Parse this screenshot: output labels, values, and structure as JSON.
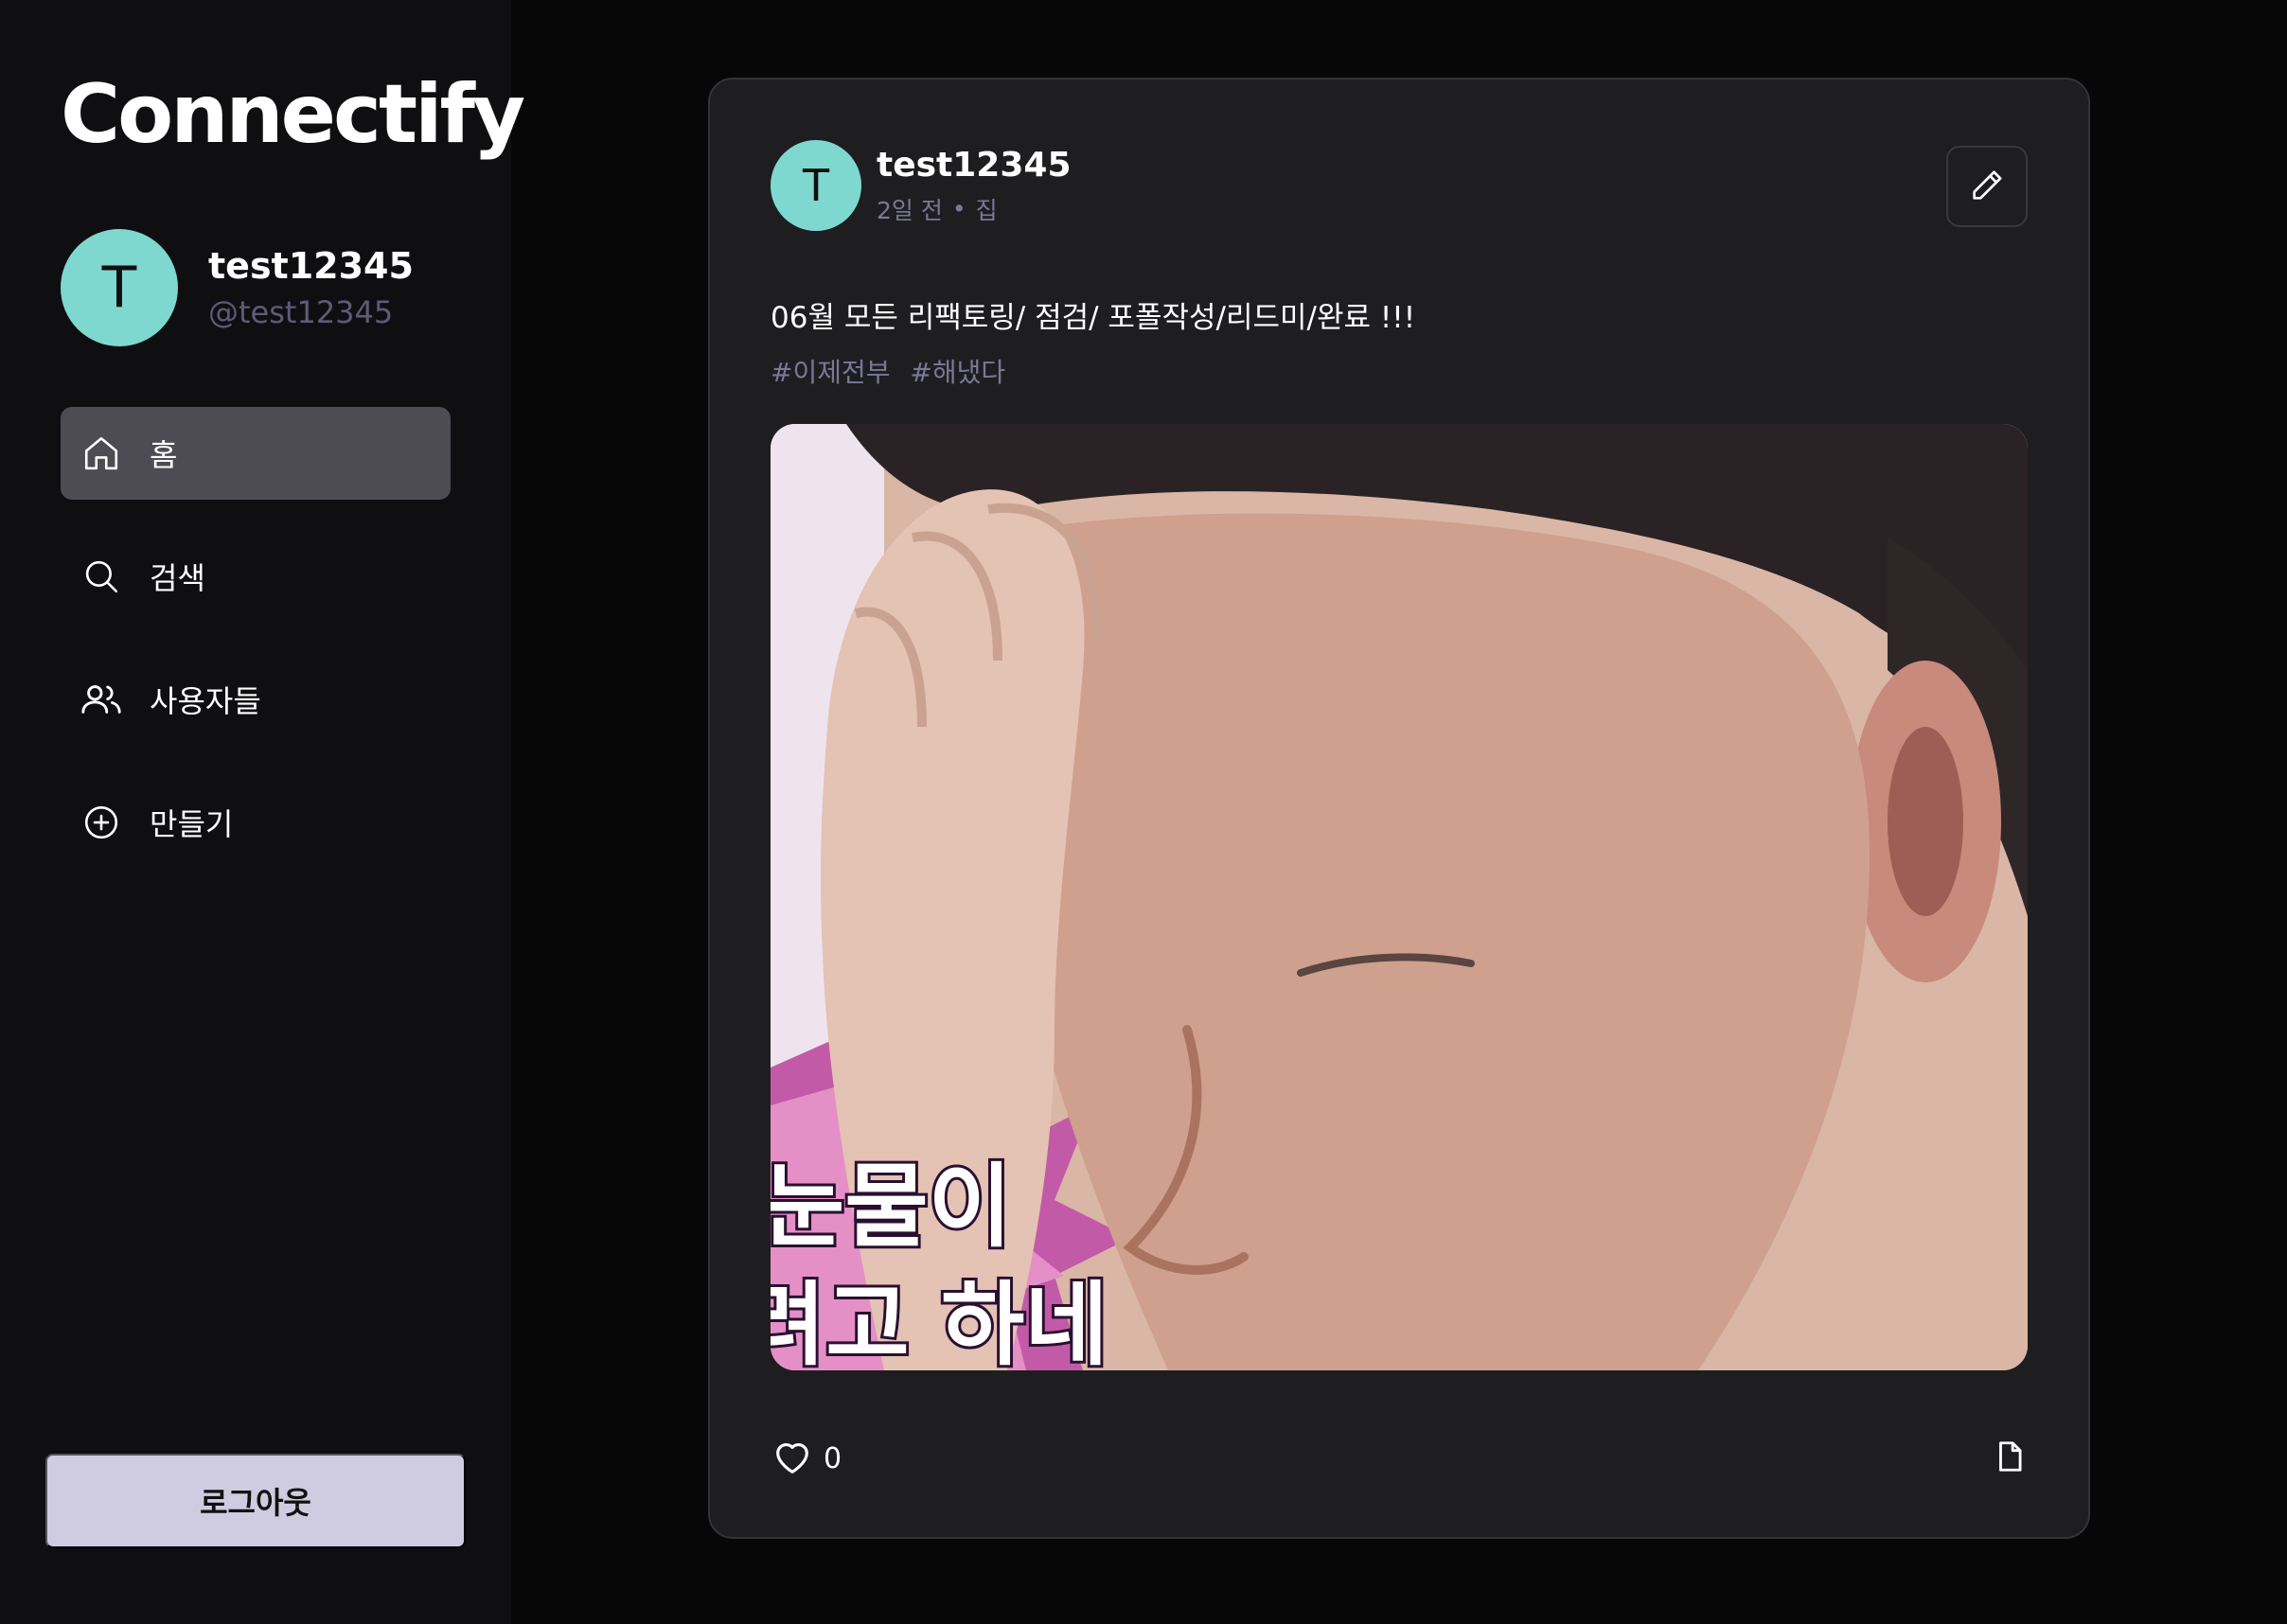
{
  "app": {
    "brand": "Connectify"
  },
  "user": {
    "initial": "T",
    "name": "test12345",
    "handle": "@test12345"
  },
  "nav": {
    "items": [
      {
        "label": "홈",
        "icon": "home-icon",
        "active": true
      },
      {
        "label": "검색",
        "icon": "search-icon",
        "active": false
      },
      {
        "label": "사용자들",
        "icon": "users-icon",
        "active": false
      },
      {
        "label": "만들기",
        "icon": "plus-circle-icon",
        "active": false
      }
    ]
  },
  "logout_label": "로그아웃",
  "post": {
    "author_initial": "T",
    "author": "test12345",
    "time": "2일 전",
    "separator": "•",
    "location": "집",
    "text": "06월 모든 리팩토링/ 점검/ 포폴작성/리드미/완료 !!!",
    "tags": [
      "#이제전부",
      "#해냈다"
    ],
    "image_caption_line1": "눈물이",
    "image_caption_line2": "려고 하네",
    "likes": "0",
    "edit_icon": "pencil-icon",
    "like_icon": "heart-icon",
    "save_icon": "document-icon"
  },
  "colors": {
    "background": "#070708",
    "sidebar": "#0f0f11",
    "card": "#1e1e21",
    "avatar": "#7fd8d0",
    "muted_text": "#7a7896",
    "nav_active": "#4c4c52",
    "logout_button": "#cfcbe0"
  }
}
